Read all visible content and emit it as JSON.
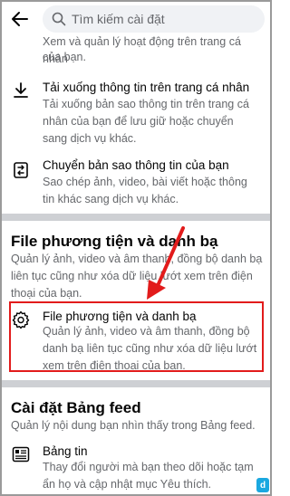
{
  "header": {
    "search_placeholder": "Tìm kiếm cài đặt"
  },
  "items": {
    "top_partial_desc_line1": "Xem và quản lý hoạt động trên trang cá nhân",
    "top_partial_desc_line2": "của bạn.",
    "download": {
      "title": "Tải xuống thông tin trên trang cá nhân",
      "desc": "Tải xuống bản sao thông tin trên trang cá nhân của bạn để lưu giữ hoặc chuyển sang dịch vụ khác."
    },
    "transfer": {
      "title": "Chuyển bản sao thông tin của bạn",
      "desc": "Sao chép ảnh, video, bài viết hoặc thông tin khác sang dịch vụ khác."
    }
  },
  "media_section": {
    "title": "File phương tiện và danh bạ",
    "desc": "Quản lý ảnh, video và âm thanh, đồng bộ danh bạ liên tục cũng như xóa dữ liệu lướt xem trên điện thoại của bạn.",
    "item": {
      "title": "File phương tiện và danh bạ",
      "desc": "Quản lý ảnh, video và âm thanh, đồng bộ danh bạ liên tục cũng như xóa dữ liệu lướt xem trên điện thoại của bạn."
    }
  },
  "feed_section": {
    "title": "Cài đặt Bảng feed",
    "desc": "Quản lý nội dung bạn nhìn thấy trong Bảng feed.",
    "item": {
      "title": "Bảng tin",
      "desc": "Thay đổi người mà bạn theo dõi hoặc tạm ẩn họ và cập nhật mục Yêu thích."
    }
  },
  "colors": {
    "highlight": "#e21b1b",
    "separator": "#ced0d4",
    "secondary_text": "#65676b"
  }
}
